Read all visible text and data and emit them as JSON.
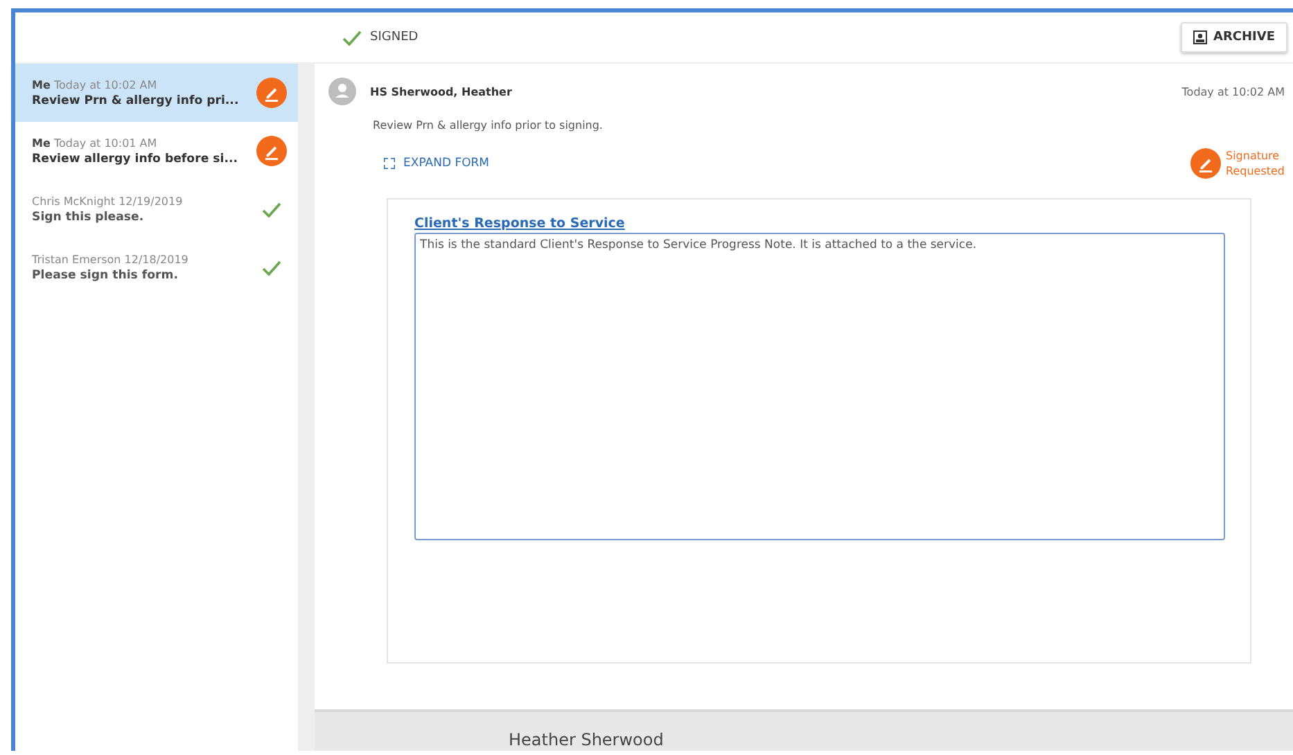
{
  "toolbar": {
    "status": "SIGNED",
    "archive_button": "ARCHIVE"
  },
  "messages": [
    {
      "sender": "Me",
      "time": "Today at 10:02 AM",
      "subject": "Review Prn & allergy info pri...",
      "kind": "pending",
      "selected": true
    },
    {
      "sender": "Me",
      "time": "Today at 10:01 AM",
      "subject": "Review allergy info before si...",
      "kind": "pending",
      "selected": false
    },
    {
      "sender": "Chris McKnight",
      "time": "12/19/2019",
      "subject": "Sign this please.",
      "kind": "signed",
      "selected": false
    },
    {
      "sender": "Tristan Emerson",
      "time": "12/18/2019",
      "subject": "Please sign this form.",
      "kind": "signed",
      "selected": false
    }
  ],
  "detail": {
    "author": "HS Sherwood, Heather",
    "time": "Today at 10:02 AM",
    "body": "Review Prn & allergy info prior to signing.",
    "expand_link": "EXPAND FORM",
    "status_lines": [
      "Signature",
      "Requested"
    ],
    "form": {
      "title": "Client's Response to Service",
      "value": "This is the standard Client's Response to Service Progress Note. It is attached to a the service."
    },
    "footer_name": "Heather Sherwood"
  }
}
